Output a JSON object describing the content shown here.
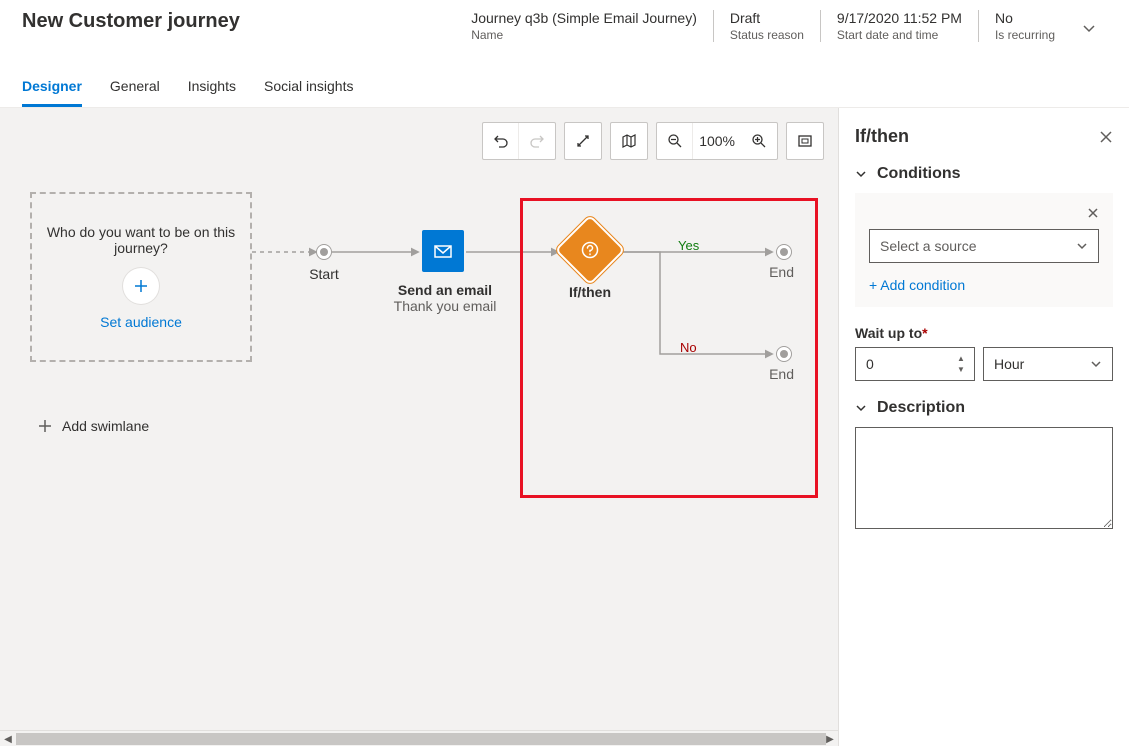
{
  "header": {
    "title": "New Customer journey",
    "fields": [
      {
        "label": "Name",
        "value": "Journey q3b (Simple Email Journey)"
      },
      {
        "label": "Status reason",
        "value": "Draft"
      },
      {
        "label": "Start date and time",
        "value": "9/17/2020 11:52 PM"
      },
      {
        "label": "Is recurring",
        "value": "No"
      }
    ]
  },
  "tabs": [
    {
      "label": "Designer",
      "active": true
    },
    {
      "label": "General",
      "active": false
    },
    {
      "label": "Insights",
      "active": false
    },
    {
      "label": "Social insights",
      "active": false
    }
  ],
  "toolbar": {
    "zoom_level": "100%"
  },
  "canvas": {
    "audience_question": "Who do you want to be on this journey?",
    "set_audience": "Set audience",
    "start_label": "Start",
    "email_title": "Send an email",
    "email_sub": "Thank you email",
    "ifthen_label": "If/then",
    "branch_yes": "Yes",
    "branch_no": "No",
    "end_label": "End",
    "add_swimlane": "Add swimlane"
  },
  "properties": {
    "title": "If/then",
    "conditions_title": "Conditions",
    "select_source_placeholder": "Select a source",
    "add_condition": "+ Add condition",
    "wait_label": "Wait up to",
    "wait_value": "0",
    "wait_unit": "Hour",
    "description_title": "Description",
    "description_value": ""
  }
}
